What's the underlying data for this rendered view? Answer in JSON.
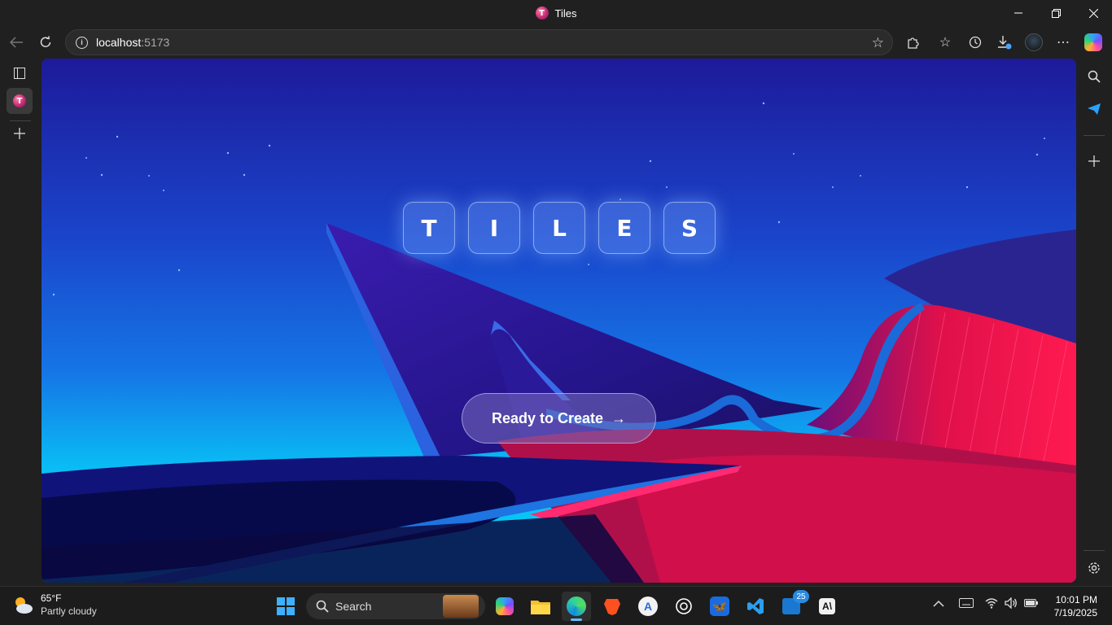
{
  "window": {
    "title": "Tiles"
  },
  "address": {
    "host": "localhost",
    "port": ":5173"
  },
  "logo": {
    "letters": [
      "T",
      "I",
      "L",
      "E",
      "S"
    ]
  },
  "cta": {
    "label": "Ready to Create",
    "arrow": "→"
  },
  "taskbar": {
    "weather": {
      "temp": "65°F",
      "condition": "Partly cloudy"
    },
    "search_label": "Search",
    "badge_count": "25",
    "clock": {
      "time": "10:01 PM",
      "date": "7/19/2025"
    }
  },
  "colors": {
    "chrome": "#202020",
    "accent_pink": "#ff1a5a",
    "sky_blue": "#1468e0"
  }
}
